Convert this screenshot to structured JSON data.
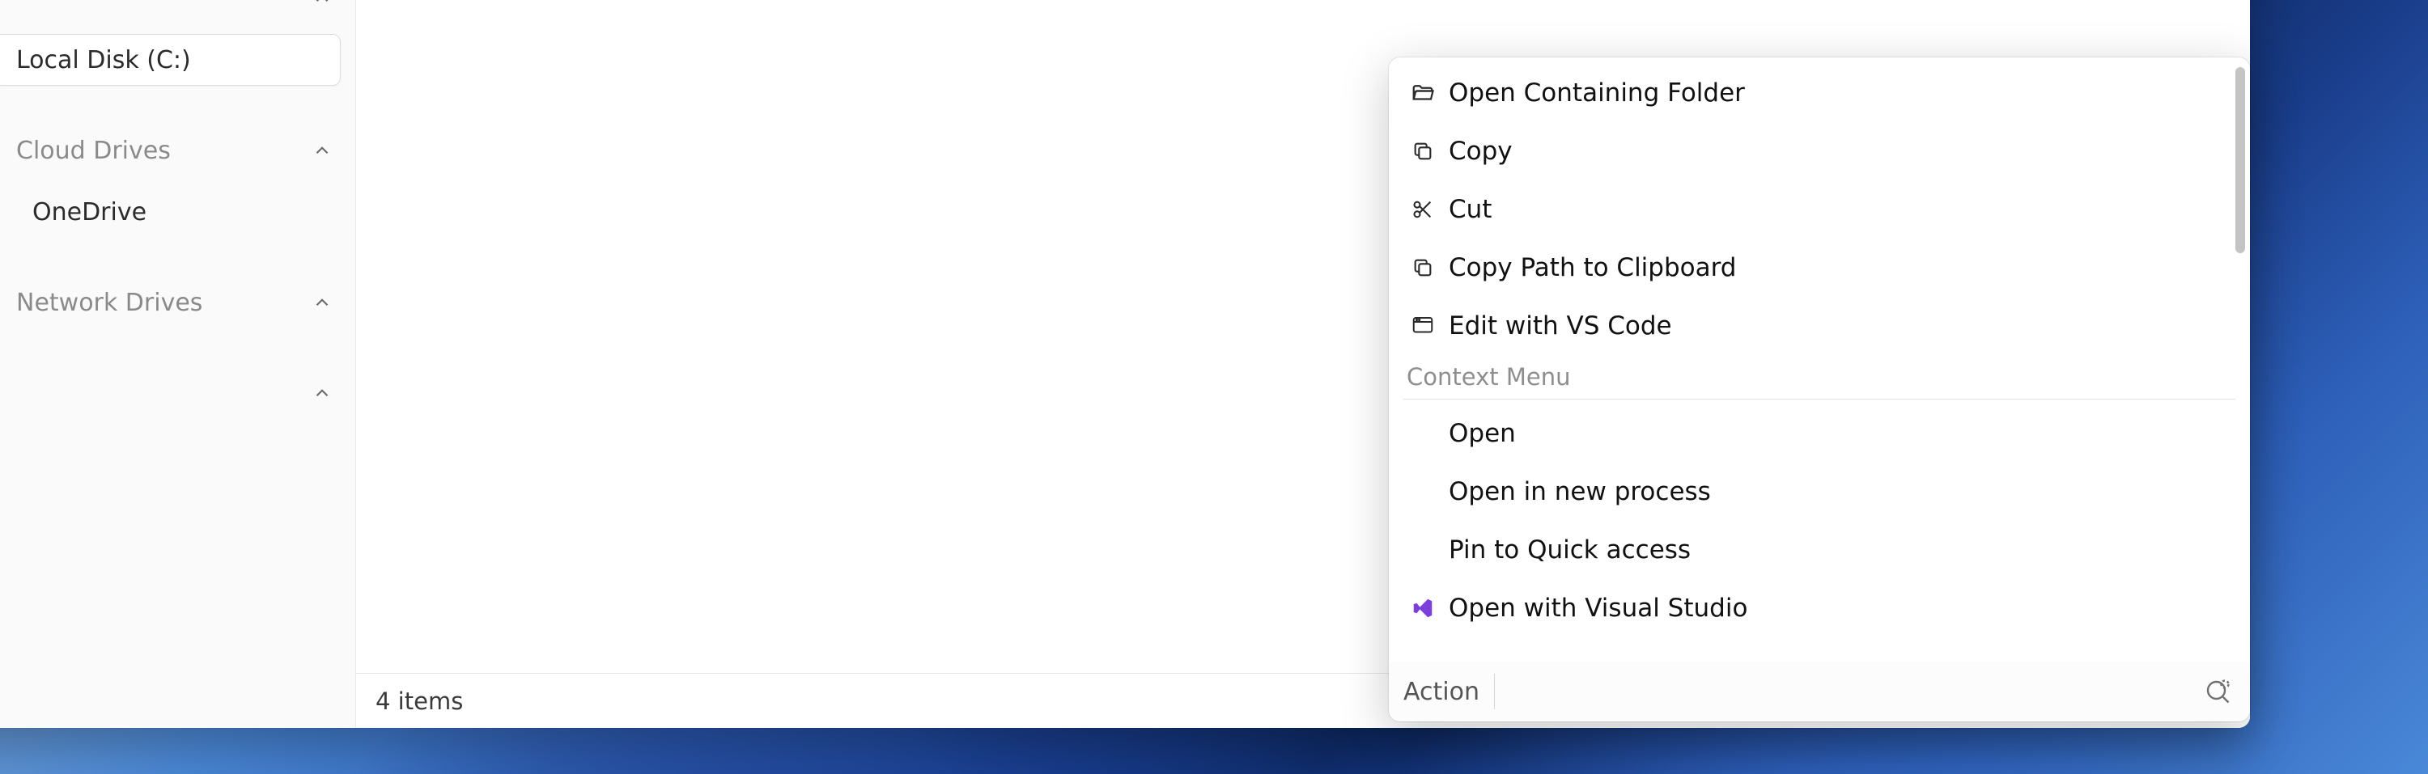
{
  "sidebar": {
    "items": [
      {
        "label": "Local Disk (C:)",
        "kind": "drive",
        "selected": true,
        "expandable": false,
        "chevron_up": true
      },
      {
        "label": "Cloud Drives",
        "kind": "group",
        "expandable": true,
        "chevron_up": true
      },
      {
        "label": "OneDrive",
        "kind": "item",
        "expandable": false
      },
      {
        "label": "Network Drives",
        "kind": "group",
        "expandable": true,
        "chevron_up": true
      },
      {
        "label": "",
        "kind": "spacer",
        "expandable": true,
        "chevron_up": true
      }
    ]
  },
  "status": {
    "item_count_text": "4 items"
  },
  "palette": {
    "primary": [
      {
        "icon": "folder-open-icon",
        "label": "Open Containing Folder"
      },
      {
        "icon": "copy-icon",
        "label": "Copy"
      },
      {
        "icon": "cut-icon",
        "label": "Cut"
      },
      {
        "icon": "copy-icon",
        "label": "Copy Path to Clipboard"
      },
      {
        "icon": "vscode-icon",
        "label": "Edit with VS Code"
      }
    ],
    "section_title": "Context Menu",
    "context": [
      {
        "icon": "",
        "label": "Open"
      },
      {
        "icon": "",
        "label": "Open in new process"
      },
      {
        "icon": "",
        "label": "Pin to Quick access"
      },
      {
        "icon": "visual-studio-icon",
        "label": "Open with Visual Studio"
      }
    ],
    "footer": {
      "label": "Action",
      "input_value": ""
    }
  }
}
